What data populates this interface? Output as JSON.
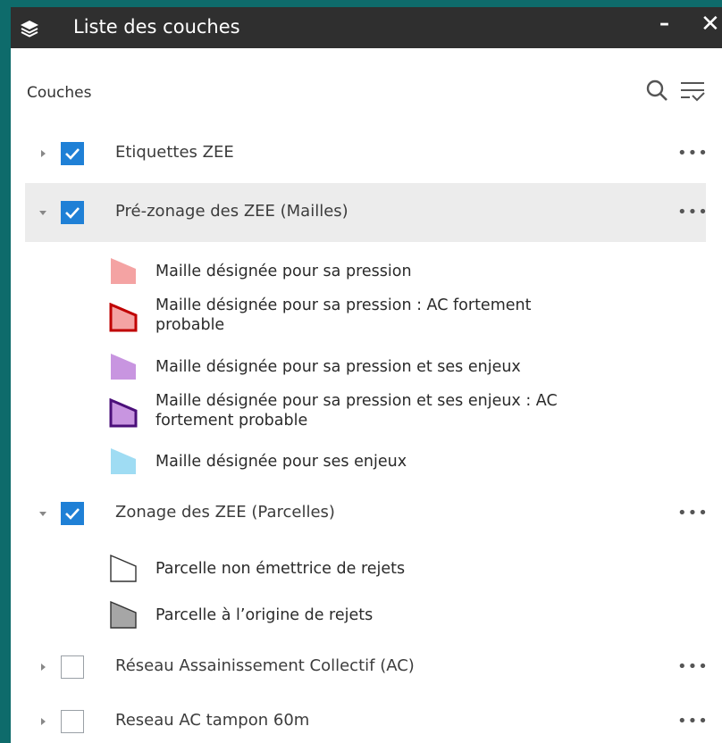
{
  "window": {
    "title": "Liste des couches",
    "minimize_label": "–",
    "close_label": "✕",
    "icon": "layers-icon"
  },
  "toolbar": {
    "section_label": "Couches",
    "search_icon": "search-icon",
    "filter_icon": "filter-list-icon"
  },
  "layers": [
    {
      "label": "Etiquettes ZEE",
      "checked": true,
      "expanded": false,
      "more_label": "•••"
    },
    {
      "label": "Pré-zonage des ZEE (Mailles)",
      "checked": true,
      "expanded": true,
      "highlighted": true,
      "more_label": "•••",
      "legend": [
        {
          "label": "Maille désignée pour sa pression",
          "fill": "#f4a3a3",
          "stroke": "#f4a3a3"
        },
        {
          "label": "Maille désignée pour sa pression : AC fortement probable",
          "fill": "#f4a3a3",
          "stroke": "#c00000"
        },
        {
          "label": "Maille désignée pour sa pression et ses enjeux",
          "fill": "#c895e0",
          "stroke": "#c895e0"
        },
        {
          "label": "Maille désignée pour sa pression et ses enjeux : AC fortement probable",
          "fill": "#c895e0",
          "stroke": "#4b0f7a"
        },
        {
          "label": "Maille désignée pour ses enjeux",
          "fill": "#9fdcf3",
          "stroke": "#9fdcf3"
        }
      ]
    },
    {
      "label": "Zonage des ZEE (Parcelles)",
      "checked": true,
      "expanded": true,
      "more_label": "•••",
      "legend": [
        {
          "label": "Parcelle non émettrice de rejets",
          "fill": "#ffffff",
          "stroke": "#333333"
        },
        {
          "label": "Parcelle à l’origine de rejets",
          "fill": "#a6a6a6",
          "stroke": "#333333"
        }
      ]
    },
    {
      "label": "Réseau Assainissement Collectif (AC)",
      "checked": false,
      "expanded": false,
      "more_label": "•••"
    },
    {
      "label": "Reseau AC tampon 60m",
      "checked": false,
      "expanded": false,
      "more_label": "•••"
    }
  ],
  "colors": {
    "accent": "#1f80d6",
    "titlebar": "#2f2f2f",
    "background": "#0e6b6b"
  }
}
